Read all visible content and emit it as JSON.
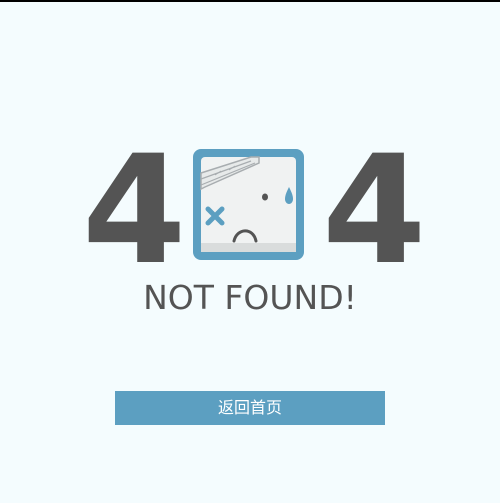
{
  "error": {
    "code_first_digit": "4",
    "code_last_digit": "4",
    "message": "NOT FOUND!"
  },
  "mascot": {
    "icon": "bandaged-sad-face-icon"
  },
  "actions": {
    "home_label": "返回首页"
  },
  "colors": {
    "background": "#f4fcfe",
    "digits": "#545454",
    "accent": "#5c9fc1",
    "button_text": "#ffffff"
  }
}
